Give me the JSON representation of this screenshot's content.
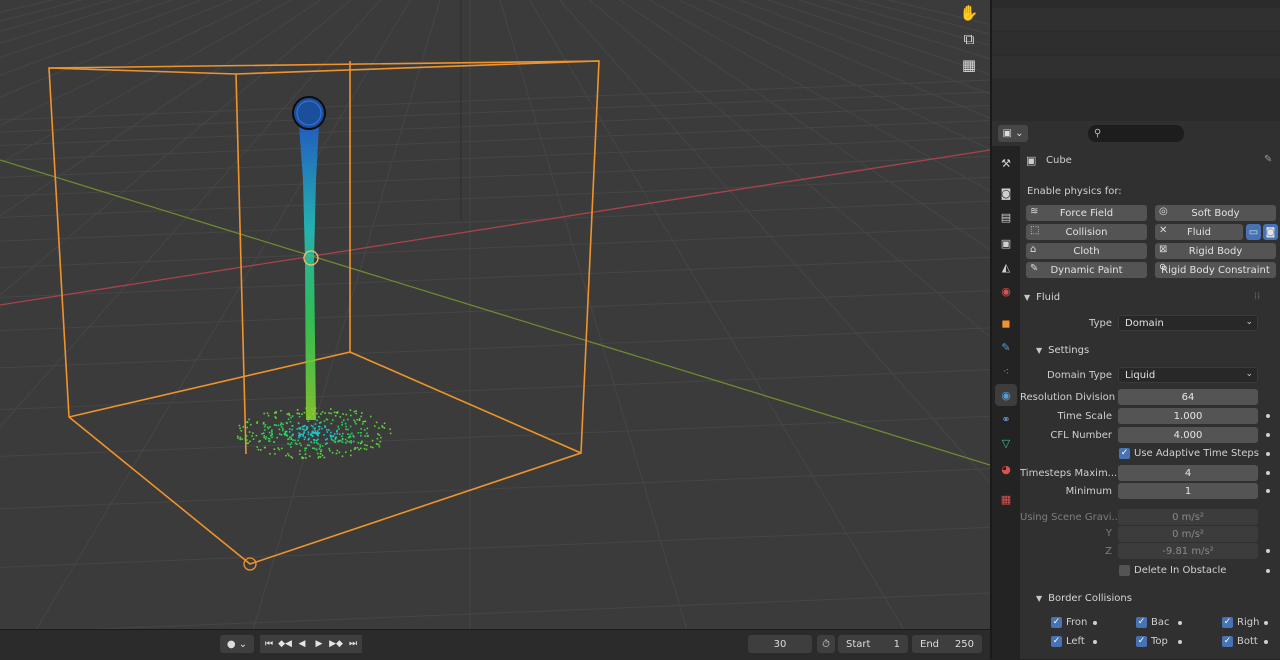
{
  "viewport": {
    "tools": [
      {
        "name": "hand-pan-icon",
        "glyph": "✋"
      },
      {
        "name": "camera-view-icon",
        "glyph": "⧉"
      },
      {
        "name": "ortho-grid-icon",
        "glyph": "▦"
      }
    ],
    "colors": {
      "selection_outline": "#f0932b",
      "x_axis": "#a8434a",
      "y_axis": "#6d8b2e",
      "grid": "#444444",
      "background": "#3b3b3b"
    }
  },
  "timeline": {
    "current_frame": "30",
    "start_label": "Start",
    "start_value": "1",
    "end_label": "End",
    "end_value": "250",
    "playback_glyphs": [
      "⏮",
      "◆◀",
      "◀",
      "▶",
      "▶◆",
      "⏭"
    ]
  },
  "properties": {
    "search_placeholder": "",
    "object_name": "Cube",
    "enable_physics_label": "Enable physics for:",
    "physics_buttons": [
      {
        "label": "Force Field",
        "icon": "≋",
        "col": 0,
        "row": 0
      },
      {
        "label": "Soft Body",
        "icon": "◎",
        "col": 1,
        "row": 0
      },
      {
        "label": "Collision",
        "icon": "⬚",
        "col": 0,
        "row": 1
      },
      {
        "label": "Fluid",
        "icon": "✕",
        "col": 1,
        "row": 1
      },
      {
        "label": "Cloth",
        "icon": "⌂",
        "col": 0,
        "row": 2
      },
      {
        "label": "Rigid Body",
        "icon": "⊠",
        "col": 1,
        "row": 2
      },
      {
        "label": "Dynamic Paint",
        "icon": "✎",
        "col": 0,
        "row": 3
      },
      {
        "label": "Rigid Body Constraint",
        "icon": "⚲",
        "col": 1,
        "row": 3
      }
    ],
    "fluid": {
      "section_label": "Fluid",
      "type_label": "Type",
      "type_value": "Domain",
      "settings_label": "Settings",
      "domain_type_label": "Domain Type",
      "domain_type_value": "Liquid",
      "resolution_label": "Resolution Division",
      "resolution_value": "64",
      "time_scale_label": "Time Scale",
      "time_scale_value": "1.000",
      "cfl_label": "CFL Number",
      "cfl_value": "4.000",
      "adaptive_label": "Use Adaptive Time Steps",
      "adaptive_checked": true,
      "timesteps_max_label": "Timesteps Maxim...",
      "timesteps_max_value": "4",
      "minimum_label": "Minimum",
      "minimum_value": "1",
      "gravity_label": "Using Scene Gravi...",
      "gravity_x": "0 m/s²",
      "y_label": "Y",
      "gravity_y": "0 m/s²",
      "z_label": "Z",
      "gravity_z": "-9.81 m/s²",
      "delete_obstacle_label": "Delete In Obstacle",
      "delete_obstacle_checked": false
    },
    "border": {
      "section_label": "Border Collisions",
      "items": [
        {
          "label": "Fron",
          "checked": true
        },
        {
          "label": "Bac",
          "checked": true
        },
        {
          "label": "Righ",
          "checked": true
        },
        {
          "label": "Left",
          "checked": true
        },
        {
          "label": "Top",
          "checked": true
        },
        {
          "label": "Bott",
          "checked": true
        }
      ]
    },
    "tabs": [
      {
        "name": "tool-tab",
        "glyph": "⚒",
        "color": "#cfcfcf"
      },
      {
        "name": "render-tab",
        "glyph": "◙",
        "color": "#cfcfcf"
      },
      {
        "name": "output-tab",
        "glyph": "▤",
        "color": "#cfcfcf"
      },
      {
        "name": "view-layer-tab",
        "glyph": "▣",
        "color": "#cfcfcf"
      },
      {
        "name": "scene-tab",
        "glyph": "◭",
        "color": "#cfcfcf"
      },
      {
        "name": "world-tab",
        "glyph": "◉",
        "color": "#d9534f"
      },
      {
        "name": "object-tab",
        "glyph": "◼",
        "color": "#f0932b"
      },
      {
        "name": "modifier-tab",
        "glyph": "✎",
        "color": "#5b9bd5"
      },
      {
        "name": "particles-tab",
        "glyph": "⁖",
        "color": "#5b9bd5"
      },
      {
        "name": "physics-tab",
        "glyph": "◉",
        "color": "#5b9bd5"
      },
      {
        "name": "constraints-tab",
        "glyph": "⚭",
        "color": "#5b9bd5"
      },
      {
        "name": "data-tab",
        "glyph": "▽",
        "color": "#3fbf8f"
      },
      {
        "name": "material-tab",
        "glyph": "◕",
        "color": "#d9534f"
      },
      {
        "name": "texture-tab",
        "glyph": "▦",
        "color": "#d9534f"
      }
    ]
  }
}
